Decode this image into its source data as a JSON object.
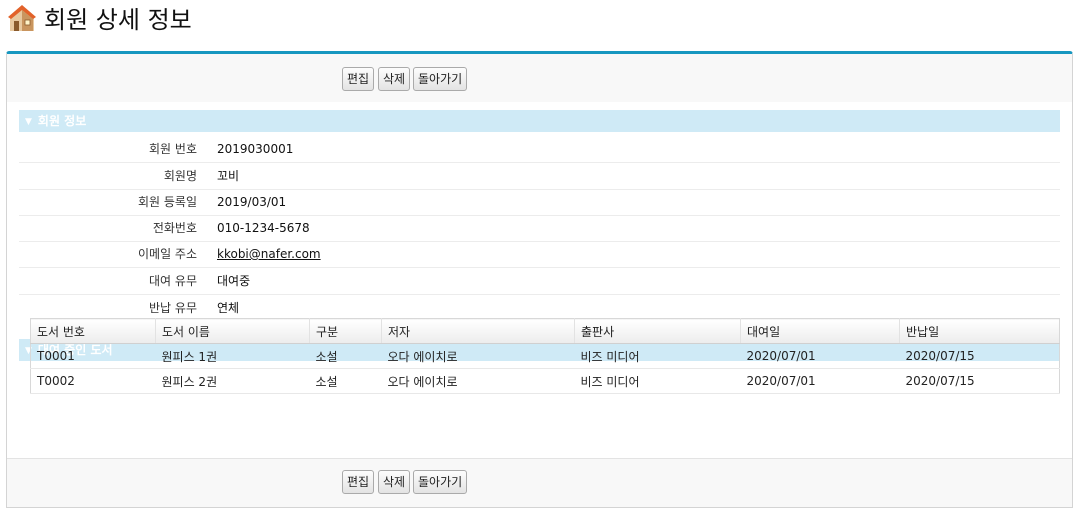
{
  "page": {
    "title": "회원 상세 정보"
  },
  "buttons": {
    "edit": "편집",
    "delete": "삭제",
    "back": "돌아가기"
  },
  "member_section": {
    "title": "회원 정보",
    "fields": [
      {
        "label": "회원 번호",
        "value": "2019030001"
      },
      {
        "label": "회원명",
        "value": "꼬비"
      },
      {
        "label": "회원 등록일",
        "value": "2019/03/01"
      },
      {
        "label": "전화번호",
        "value": "010-1234-5678"
      },
      {
        "label": "이메일 주소",
        "value": "kkobi@nafer.com"
      },
      {
        "label": "대여 유무",
        "value": "대여중"
      },
      {
        "label": "반납 유무",
        "value": "연체"
      }
    ]
  },
  "books_section": {
    "title": "대여 중인 도서",
    "columns": [
      "도서 번호",
      "도서 이름",
      "구분",
      "저자",
      "출판사",
      "대여일",
      "반납일"
    ],
    "rows": [
      [
        "T0001",
        "원피스 1권",
        "소설",
        "오다 에이치로",
        "비즈 미디어",
        "2020/07/01",
        "2020/07/15"
      ],
      [
        "T0002",
        "원피스 2권",
        "소설",
        "오다 에이치로",
        "비즈 미디어",
        "2020/07/01",
        "2020/07/15"
      ]
    ]
  },
  "colors": {
    "accent": "#1797c0",
    "section_bg": "#cfeaf6"
  }
}
